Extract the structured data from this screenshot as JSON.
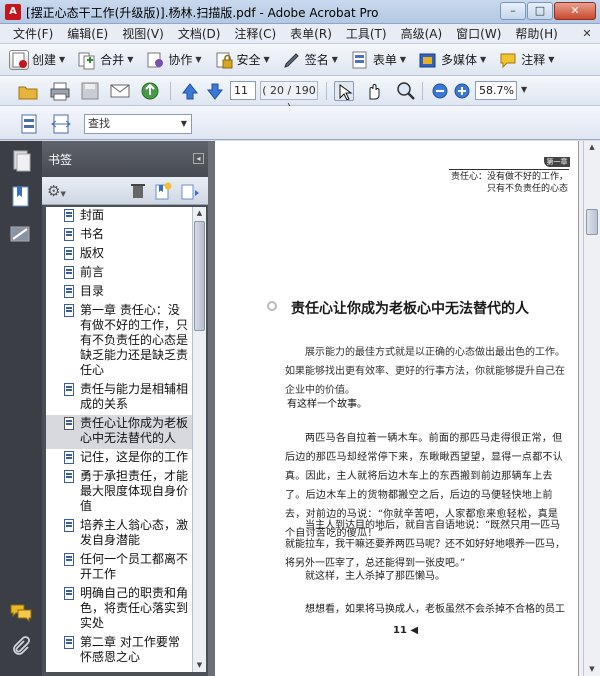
{
  "window": {
    "title": "[摆正心态干工作(升级版)].杨林.扫描版.pdf - Adobe Acrobat Pro",
    "controls": {
      "minimize": "–",
      "maximize": "□",
      "close": "✕"
    }
  },
  "menu": [
    "文件(F)",
    "编辑(E)",
    "视图(V)",
    "文档(D)",
    "注释(C)",
    "表单(R)",
    "工具(T)",
    "高级(A)",
    "窗口(W)",
    "帮助(H)"
  ],
  "tasks": [
    {
      "label": "创建",
      "icon": "create-icon"
    },
    {
      "label": "合并",
      "icon": "combine-icon"
    },
    {
      "label": "协作",
      "icon": "collaborate-icon"
    },
    {
      "label": "安全",
      "icon": "secure-icon"
    },
    {
      "label": "签名",
      "icon": "sign-icon"
    },
    {
      "label": "表单",
      "icon": "forms-icon"
    },
    {
      "label": "多媒体",
      "icon": "multimedia-icon"
    },
    {
      "label": "注释",
      "icon": "comment-icon"
    }
  ],
  "nav": {
    "current_page": "11",
    "page_count": "( 20 / 190 )",
    "zoom": "58.7%"
  },
  "find": {
    "value": "查找"
  },
  "bookmarks": {
    "title": "书签",
    "items": [
      {
        "label": "封面"
      },
      {
        "label": "书名"
      },
      {
        "label": "版权"
      },
      {
        "label": "前言"
      },
      {
        "label": "目录"
      },
      {
        "label": "第一章 责任心：没有做不好的工作，只有不负责任的心态是缺乏能力还是缺乏责任心"
      },
      {
        "label": "责任与能力是相辅相成的关系"
      },
      {
        "label": "责任心让你成为老板心中无法替代的人",
        "active": true
      },
      {
        "label": "记住，这是你的工作"
      },
      {
        "label": "勇于承担责任，才能最大限度体现自身价值"
      },
      {
        "label": "培养主人翁心态，激发自身潜能"
      },
      {
        "label": "任何一个员工都离不开工作"
      },
      {
        "label": "明确自己的职责和角色，将责任心落实到实处"
      },
      {
        "label": "第二章 对工作要常怀感恩之心"
      }
    ]
  },
  "document": {
    "chapter_tag": "第一章",
    "running_head_1": "责任心：没有做不好的工作，",
    "running_head_2": "只有不负责任的心态",
    "section_title": "责任心让你成为老板心中无法替代的人",
    "para1": "展示能力的最佳方式就是以正确的心态做出最出色的工作。如果能够找出更有效率、更好的行事方法，你就能够提升自己在企业中的价值。",
    "para2": "有这样一个故事。",
    "para3": "两匹马各自拉着一辆木车。前面的那匹马走得很正常，但后边的那匹马却经常停下来，东瞅瞅西望望，显得一点都不认真。因此，主人就将后边木车上的东西搬到前边那辆车上去了。后边木车上的货物都搬空之后，后边的马便轻快地上前去，对前边的马说：“你就辛苦吧，人家都愈来愈轻松，真是个自讨苦吃的傻瓜！”",
    "para4": "当主人到达目的地后，就自言自语地说：“既然只用一匹马就能拉车，我干嘛还要养两匹马呢？还不如好好地喂养一匹马，将另外一匹宰了，总还能得到一张皮吧。”",
    "para5": "就这样，主人杀掉了那匹懒马。",
    "para6": "想想看，如果将马换成人，老板虽然不会杀掉不合格的员工，",
    "page_number": "11 ◀"
  }
}
